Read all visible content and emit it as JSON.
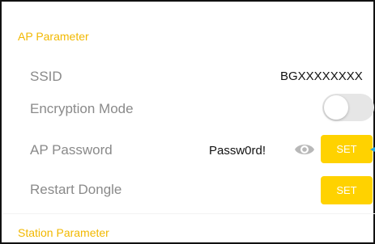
{
  "ap_section": {
    "title": "AP Parameter",
    "rows": {
      "ssid": {
        "label": "SSID",
        "value": "BGXXXXXXXX"
      },
      "encryption": {
        "label": "Encryption Mode",
        "enabled": false
      },
      "password": {
        "label": "AP Password",
        "value": "Passw0rd!",
        "button": "SET"
      },
      "restart": {
        "label": "Restart Dongle",
        "button": "SET"
      }
    }
  },
  "station_section": {
    "title": "Station Parameter"
  },
  "colors": {
    "accent": "#ffd200",
    "header": "#f2b800",
    "label": "#8a8a8a",
    "toggle_off": "#e6e6e6",
    "pointer": "#1ea7e0"
  },
  "icons": {
    "show_password": "eye-icon",
    "pointer": "arrow-left-icon"
  }
}
